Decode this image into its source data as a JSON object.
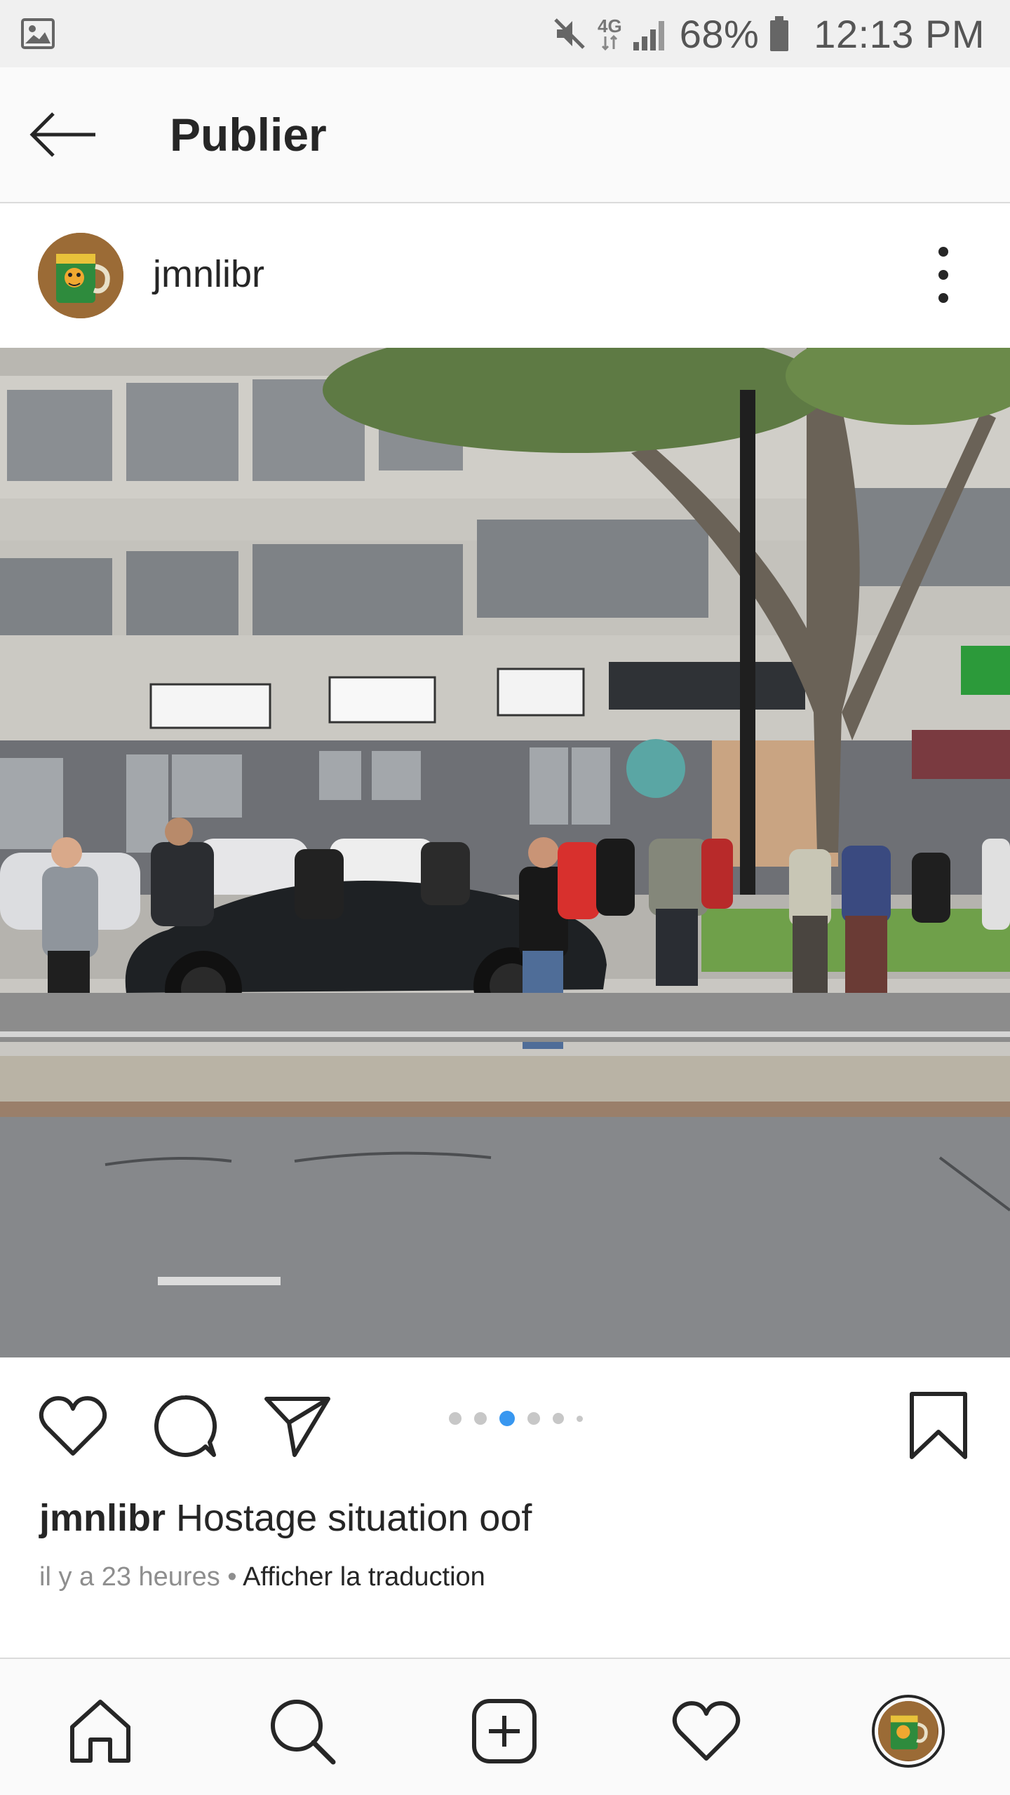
{
  "status_bar": {
    "network": "4G",
    "battery": "68%",
    "time": "12:13 PM"
  },
  "app_bar": {
    "title": "Publier"
  },
  "post": {
    "username": "jmnlibr",
    "carousel": {
      "total": 5,
      "active": 3
    },
    "caption": {
      "username": "jmnlibr",
      "text": "Hostage situation oof"
    },
    "time_ago": "il y a 23 heures",
    "separator": "•",
    "translate": "Afficher la traduction"
  },
  "colors": {
    "accent_blue": "#3897f0",
    "text": "#262626",
    "muted": "#8e8e8e"
  }
}
